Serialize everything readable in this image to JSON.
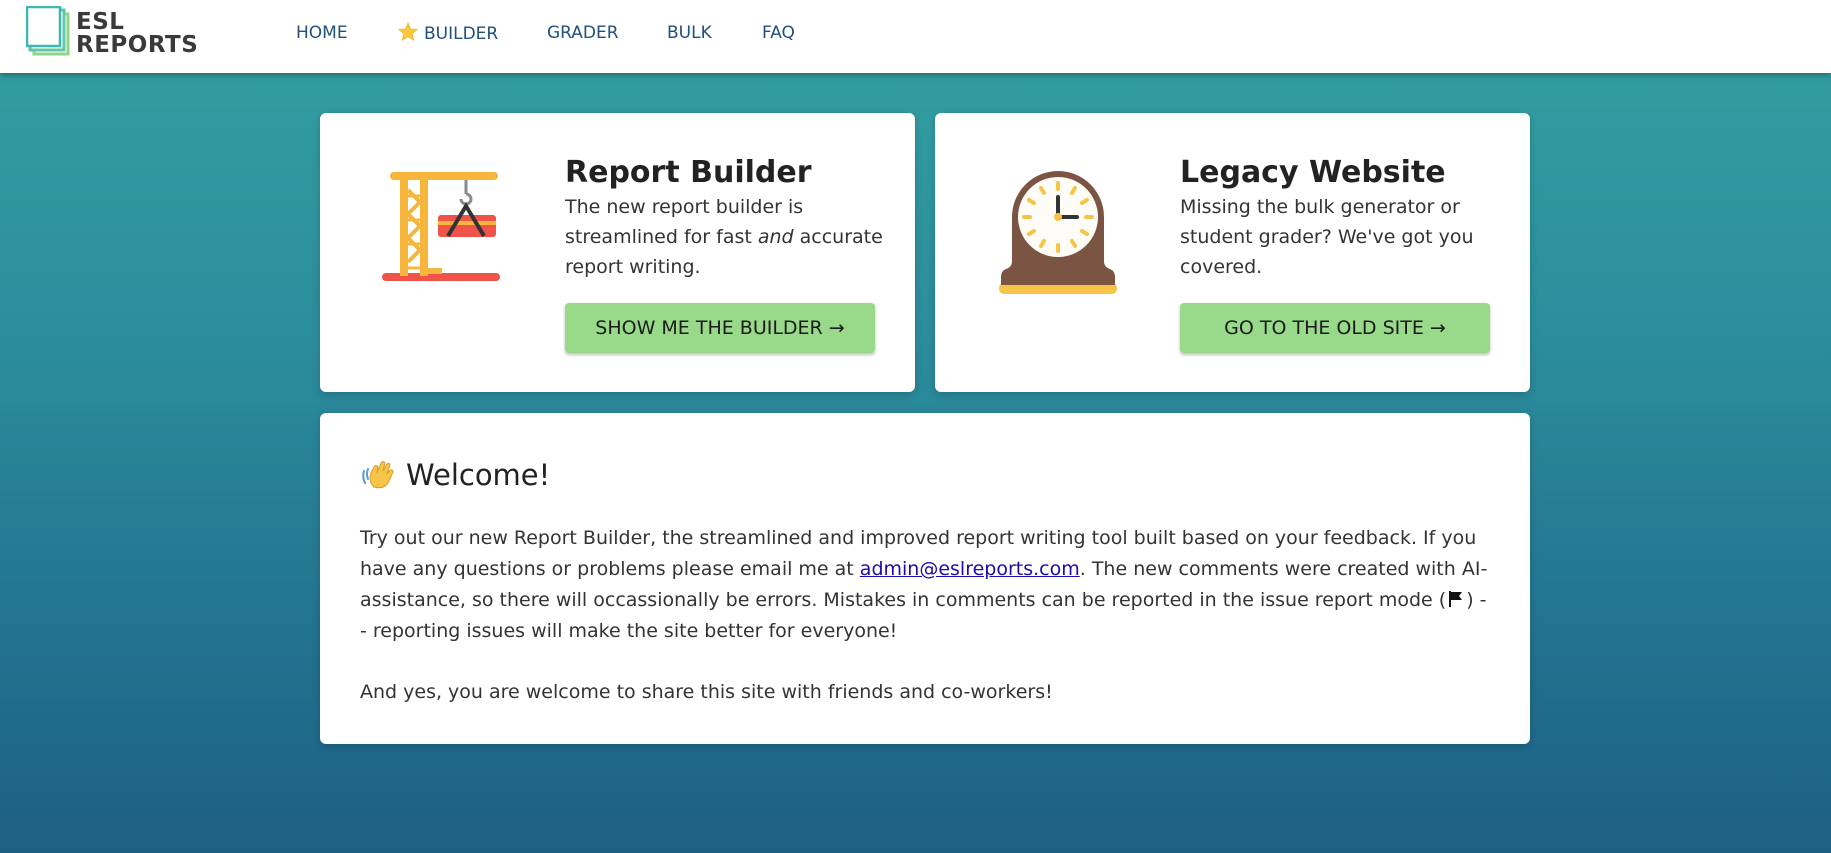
{
  "app": {
    "logo_line1": "ESL",
    "logo_line2": "REPORTS"
  },
  "nav": {
    "items": [
      {
        "label": "HOME",
        "icon": ""
      },
      {
        "label": "BUILDER",
        "icon": "star-icon"
      },
      {
        "label": "GRADER",
        "icon": ""
      },
      {
        "label": "BULK",
        "icon": ""
      },
      {
        "label": "FAQ",
        "icon": ""
      }
    ]
  },
  "cards": {
    "builder": {
      "icon": "crane-icon",
      "title": "Report Builder",
      "desc_part1": "The new report builder is streamlined for fast ",
      "desc_emphasis": "and",
      "desc_part2": " accurate report writing.",
      "button": "SHOW ME THE BUILDER →"
    },
    "legacy": {
      "icon": "mantel-clock-icon",
      "title": "Legacy Website",
      "desc": "Missing the bulk generator or student grader? We've got you covered.",
      "button": "GO TO THE OLD SITE →"
    }
  },
  "welcome": {
    "icon": "waving-hand-icon",
    "title": "Welcome!",
    "p1_a": "Try out our new Report Builder, the streamlined and improved report writing tool built based on your feedback. If you have any questions or problems please email me at ",
    "email": "admin@eslreports.com",
    "p1_b": ". The new comments were created with AI-assistance, so there will occassionally be errors. Mistakes in comments can be reported in the issue report mode (",
    "p1_flag_icon": "flag-icon",
    "p1_c": ") -- reporting issues will make the site better for everyone!",
    "p2": "And yes, you are welcome to share this site with friends and co-workers!"
  },
  "colors": {
    "nav_text": "#22507a",
    "button_bg": "#98d98a",
    "bg_top": "#34a1a2",
    "bg_bottom": "#1d5f84"
  }
}
